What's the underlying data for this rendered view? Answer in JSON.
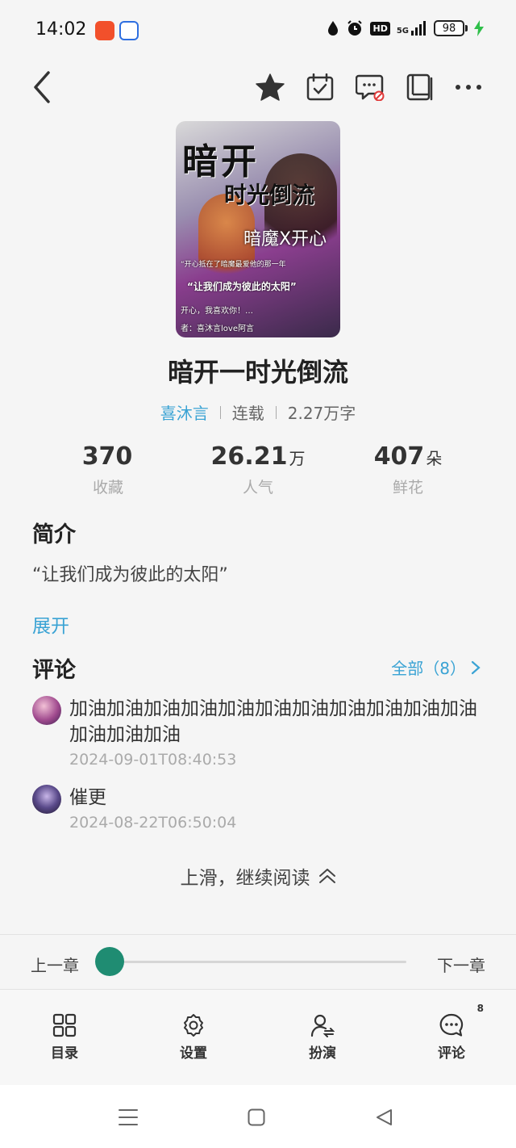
{
  "status_bar": {
    "time": "14:02",
    "battery": "98",
    "network": "5G",
    "hd": "HD"
  },
  "header": {
    "icons": [
      "back-arrow-icon",
      "star-icon",
      "calendar-check-icon",
      "comment-off-icon",
      "book-icon",
      "more-icon"
    ]
  },
  "cover": {
    "title_text": "暗开",
    "subtitle_text": "时光倒流",
    "tag_text": "暗魔X开心",
    "line1": "“开心抵在了暗魔最爱他的那一年",
    "line2": "“让我们成为彼此的太阳”",
    "line3": "开心，我喜欢你！…",
    "line4": "者：喜沐言love阿言"
  },
  "book": {
    "title": "暗开一时光倒流",
    "author": "喜沐言",
    "status": "连载",
    "word_count": "2.27万字"
  },
  "stats": {
    "favorites": {
      "value": "370",
      "unit": "",
      "label": "收藏"
    },
    "popularity": {
      "value": "26.21",
      "unit": "万",
      "label": "人气"
    },
    "flowers": {
      "value": "407",
      "unit": "朵",
      "label": "鲜花"
    }
  },
  "intro": {
    "heading": "简介",
    "text": "“让我们成为彼此的太阳”",
    "expand": "展开"
  },
  "comments": {
    "heading": "评论",
    "all_label": "全部（8）",
    "items": [
      {
        "text": "加油加油加油加油加油加油加油加油加油加油加油加油加油加油",
        "time": "2024-09-01T08:40:53"
      },
      {
        "text": "催更",
        "time": "2024-08-22T06:50:04"
      }
    ]
  },
  "continue_label": "上滑，继续阅读",
  "chapter_nav": {
    "prev": "上一章",
    "next": "下一章",
    "progress": 0
  },
  "toolbar": {
    "toc": "目录",
    "settings": "设置",
    "roleplay": "扮演",
    "comments": "评论",
    "comments_badge": "8"
  },
  "colors": {
    "accent": "#3aa3d4",
    "slider": "#1f8c72",
    "background": "#f5f5f5"
  }
}
